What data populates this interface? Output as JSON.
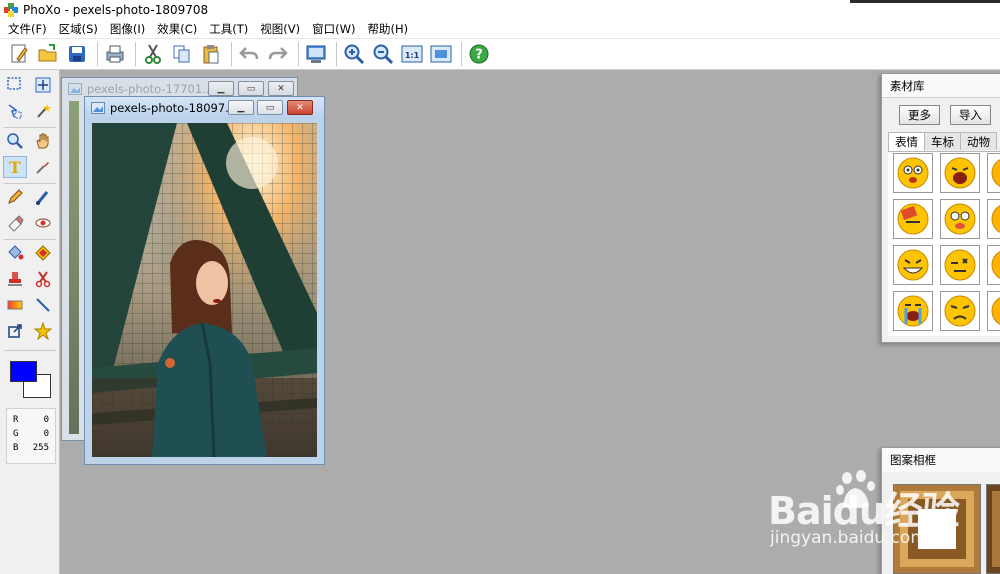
{
  "window": {
    "app_name": "PhoXo",
    "title": "PhoXo - pexels-photo-1809708"
  },
  "menu": [
    "文件(F)",
    "区域(S)",
    "图像(I)",
    "效果(C)",
    "工具(T)",
    "视图(V)",
    "窗口(W)",
    "帮助(H)"
  ],
  "toolbar": {
    "icons": [
      "new-file-icon",
      "open-folder-icon",
      "save-icon",
      "print-icon",
      "cut-icon",
      "copy-icon",
      "paste-icon",
      "undo-icon",
      "redo-icon",
      "screen-capture-icon",
      "zoom-in-icon",
      "zoom-out-icon",
      "actual-size-icon",
      "fit-window-icon",
      "help-icon"
    ],
    "actual_size_label": "1:1",
    "help_label": "?"
  },
  "tools": {
    "items": [
      "rect-select",
      "move",
      "magic-select",
      "magic-wand",
      "zoom",
      "hand",
      "text",
      "eyedropper",
      "pencil",
      "brush",
      "eraser",
      "red-eye",
      "fill",
      "color-replace",
      "stamp",
      "scissors",
      "gradient",
      "line",
      "transform",
      "star"
    ],
    "active": "text",
    "text_glyph": "T"
  },
  "colors": {
    "foreground": "#0000ff",
    "background": "#ffffff"
  },
  "rgb": {
    "r_label": "R",
    "r_value": "0",
    "g_label": "G",
    "g_value": "0",
    "b_label": "B",
    "b_value": "255"
  },
  "image_windows": {
    "back_title": "pexels-photo-17701...",
    "front_title": "pexels-photo-18097..."
  },
  "material_panel": {
    "title": "素材库",
    "more_button": "更多",
    "import_button": "导入",
    "tabs": [
      "表情",
      "车标",
      "动物"
    ],
    "active_tab": "表情"
  },
  "frames_panel": {
    "title": "图案相框"
  },
  "watermark": {
    "brand": "Baidu经验",
    "url": "jingyan.baidu.com"
  }
}
